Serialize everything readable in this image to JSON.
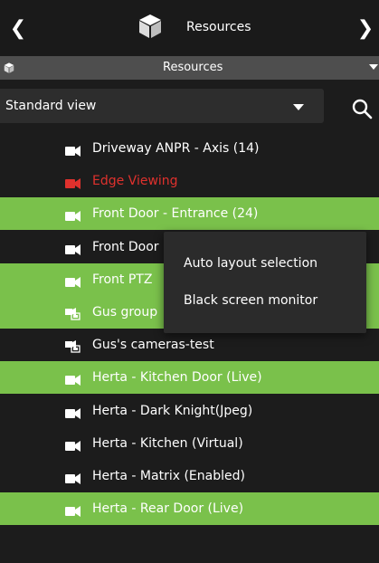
{
  "header": {
    "title": "Resources",
    "prev_icon": "chevron-left-icon",
    "next_icon": "chevron-right-icon",
    "cube_icon": "cube-icon"
  },
  "subheader": {
    "title": "Resources",
    "caret_icon": "caret-down-icon"
  },
  "view_selector": {
    "value": "Standard view",
    "search_icon": "search-icon"
  },
  "colors": {
    "selected_row": "#7ac14b",
    "alert_text": "#e0312d",
    "background": "#1c1c1c",
    "menu_background": "#2b2b2b"
  },
  "tree": {
    "items": [
      {
        "label": "Driveway ANPR - Axis (14)",
        "icon": "camera-icon",
        "selected": false,
        "alert": false
      },
      {
        "label": "Edge Viewing",
        "icon": "camera-icon",
        "selected": false,
        "alert": true
      },
      {
        "label": "Front Door - Entrance (24)",
        "icon": "camera-icon",
        "selected": true,
        "alert": false
      },
      {
        "label": "Front Door",
        "icon": "camera-icon",
        "selected": false,
        "alert": false
      },
      {
        "label": "Front PTZ",
        "icon": "camera-icon",
        "selected": true,
        "alert": false
      },
      {
        "label": "Gus group",
        "icon": "camera-group-icon",
        "selected": true,
        "alert": false
      },
      {
        "label": "Gus's cameras-test",
        "icon": "camera-group-icon",
        "selected": false,
        "alert": false
      },
      {
        "label": "Herta  - Kitchen Door (Live)",
        "icon": "camera-icon",
        "selected": true,
        "alert": false
      },
      {
        "label": "Herta - Dark Knight(Jpeg)",
        "icon": "camera-icon",
        "selected": false,
        "alert": false
      },
      {
        "label": "Herta - Kitchen (Virtual)",
        "icon": "camera-icon",
        "selected": false,
        "alert": false
      },
      {
        "label": "Herta - Matrix (Enabled)",
        "icon": "camera-icon",
        "selected": false,
        "alert": false
      },
      {
        "label": "Herta - Rear Door (Live)",
        "icon": "camera-icon",
        "selected": true,
        "alert": false
      }
    ]
  },
  "context_menu": {
    "items": [
      {
        "label": "Auto layout selection"
      },
      {
        "label": "Black screen monitor"
      }
    ]
  }
}
